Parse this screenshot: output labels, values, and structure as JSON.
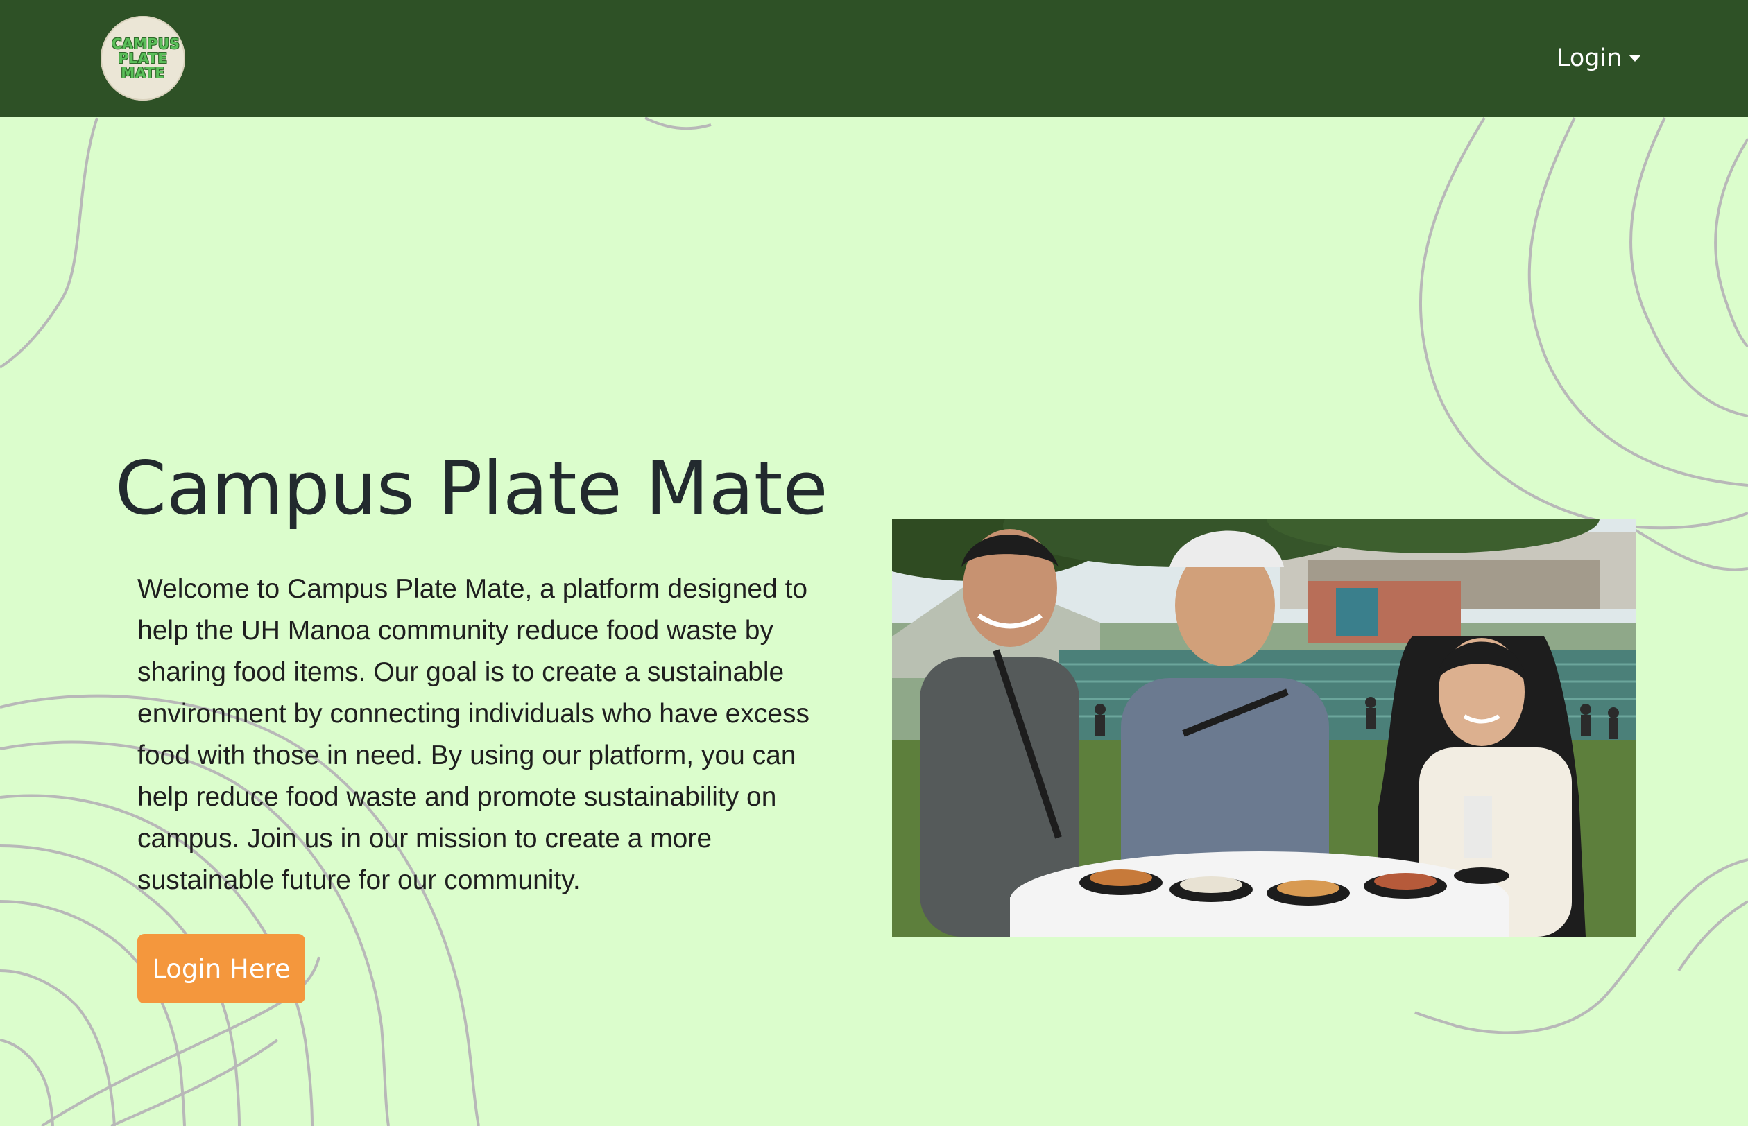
{
  "navbar": {
    "logo_text": "CAMPUS PLATE MATE",
    "login_menu_label": "Login"
  },
  "hero": {
    "title": "Campus Plate Mate",
    "description": "Welcome to Campus Plate Mate, a platform designed to help the UH Manoa community reduce food waste by sharing food items. Our goal is to create a sustainable environment by connecting individuals who have excess food with those in need. By using our platform, you can help reduce food waste and promote sustainability on campus. Join us in our mission to create a more sustainable future for our community.",
    "login_button_label": "Login Here",
    "photo_alt": "Students smiling at a table of food on campus"
  },
  "colors": {
    "navbar_bg": "#2e5126",
    "page_bg": "#dbfdcc",
    "button_bg": "#f4973d",
    "decor_lines": "#b8b8b8"
  },
  "icons": {
    "login_caret": "caret-down-icon"
  }
}
